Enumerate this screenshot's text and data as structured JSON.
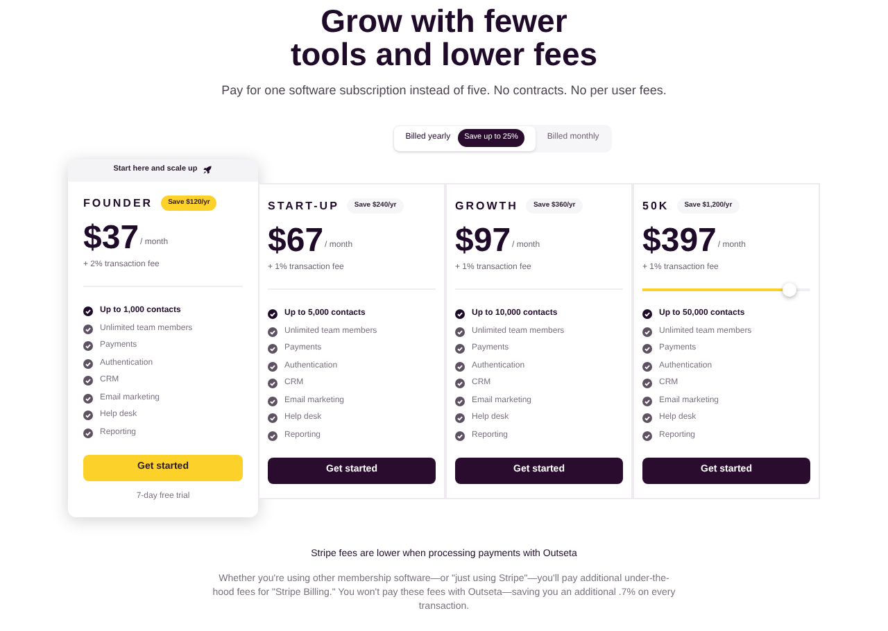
{
  "heading": [
    "Grow with fewer",
    "tools and lower fees"
  ],
  "subtitle": "Pay for one software subscription instead of five. No contracts. No per user fees.",
  "billing_toggle": [
    {
      "label": "Billed yearly",
      "badge": "Save up to 25%",
      "selected": true
    },
    {
      "label": "Billed monthly",
      "selected": false
    }
  ],
  "plans": [
    {
      "featured": true,
      "banner": "Start here and scale up",
      "name": "FOUNDER",
      "save": "Save $120/yr",
      "price": "$37",
      "period": "/ month",
      "fee": "+ 2% transaction fee",
      "features": [
        "Up to 1,000 contacts",
        "Unlimited team members",
        "Payments",
        "Authentication",
        "CRM",
        "Email marketing",
        "Help desk",
        "Reporting"
      ],
      "button": "Get started",
      "note": "7-day free trial"
    },
    {
      "featured": false,
      "name": "START-UP",
      "save": "Save $240/yr",
      "price": "$67",
      "period": "/ month",
      "fee": "+ 1% transaction fee",
      "features": [
        "Up to 5,000 contacts",
        "Unlimited team members",
        "Payments",
        "Authentication",
        "CRM",
        "Email marketing",
        "Help desk",
        "Reporting"
      ],
      "button": "Get started"
    },
    {
      "featured": false,
      "name": "GROWTH",
      "save": "Save $360/yr",
      "price": "$97",
      "period": "/ month",
      "fee": "+ 1% transaction fee",
      "features": [
        "Up to 10,000 contacts",
        "Unlimited team members",
        "Payments",
        "Authentication",
        "CRM",
        "Email marketing",
        "Help desk",
        "Reporting"
      ],
      "button": "Get started"
    },
    {
      "featured": false,
      "name": "50K",
      "save": "Save $1,200/yr",
      "price": "$397",
      "period": "/ month",
      "fee": "+ 1% transaction fee",
      "slider": {
        "level": 0.88
      },
      "features": [
        "Up to 50,000 contacts",
        "Unlimited team members",
        "Payments",
        "Authentication",
        "CRM",
        "Email marketing",
        "Help desk",
        "Reporting"
      ],
      "button": "Get started"
    }
  ],
  "fees_title": "Stripe fees are lower when processing payments with Outseta",
  "fees_text": "Whether you're using other membership software—or \"just using Stripe\"—you'll pay additional under-the-hood fees for \"Stripe Billing.\" You won't pay these fees with Outseta—saving you an additional .7% on every transaction."
}
